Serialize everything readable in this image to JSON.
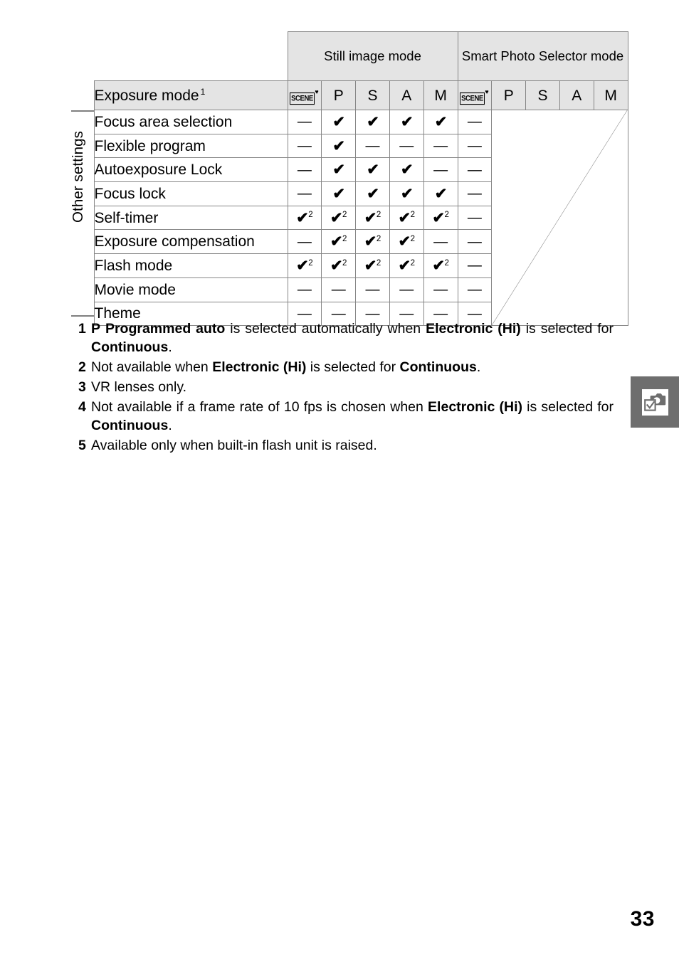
{
  "page": {
    "number": "33"
  },
  "table": {
    "side_label": "Other settings",
    "group_headers": [
      {
        "label": "Still image mode",
        "span": 5
      },
      {
        "label": "Smart Photo Selector mode",
        "span": 5
      }
    ],
    "exposure_row_label": "Exposure mode",
    "exposure_row_footnote": "1",
    "mode_columns": [
      {
        "icon": "scene-icon",
        "label": "SCENE",
        "accent": "♥"
      },
      {
        "label": "P"
      },
      {
        "label": "S"
      },
      {
        "label": "A"
      },
      {
        "label": "M"
      },
      {
        "icon": "scene-icon",
        "label": "SCENE",
        "accent": "♥"
      },
      {
        "label": "P"
      },
      {
        "label": "S"
      },
      {
        "label": "A"
      },
      {
        "label": "M"
      }
    ],
    "dash": "—",
    "check": "✔",
    "rows": [
      {
        "name": "Focus area selection",
        "cells": [
          {
            "mark": "—"
          },
          {
            "mark": "✔"
          },
          {
            "mark": "✔"
          },
          {
            "mark": "✔"
          },
          {
            "mark": "✔"
          },
          {
            "mark": "—"
          }
        ]
      },
      {
        "name": "Flexible program",
        "cells": [
          {
            "mark": "—"
          },
          {
            "mark": "✔"
          },
          {
            "mark": "—"
          },
          {
            "mark": "—"
          },
          {
            "mark": "—"
          },
          {
            "mark": "—"
          }
        ]
      },
      {
        "name": "Autoexposure Lock",
        "cells": [
          {
            "mark": "—"
          },
          {
            "mark": "✔"
          },
          {
            "mark": "✔"
          },
          {
            "mark": "✔"
          },
          {
            "mark": "—"
          },
          {
            "mark": "—"
          }
        ]
      },
      {
        "name": "Focus lock",
        "cells": [
          {
            "mark": "—"
          },
          {
            "mark": "✔"
          },
          {
            "mark": "✔"
          },
          {
            "mark": "✔"
          },
          {
            "mark": "✔"
          },
          {
            "mark": "—"
          }
        ]
      },
      {
        "name": "Self-timer",
        "cells": [
          {
            "mark": "✔",
            "note": "2"
          },
          {
            "mark": "✔",
            "note": "2"
          },
          {
            "mark": "✔",
            "note": "2"
          },
          {
            "mark": "✔",
            "note": "2"
          },
          {
            "mark": "✔",
            "note": "2"
          },
          {
            "mark": "—"
          }
        ]
      },
      {
        "name": "Exposure compensation",
        "cells": [
          {
            "mark": "—"
          },
          {
            "mark": "✔",
            "note": "2"
          },
          {
            "mark": "✔",
            "note": "2"
          },
          {
            "mark": "✔",
            "note": "2"
          },
          {
            "mark": "—"
          },
          {
            "mark": "—"
          }
        ]
      },
      {
        "name": "Flash mode",
        "cells": [
          {
            "mark": "✔",
            "note": "2"
          },
          {
            "mark": "✔",
            "note": "2"
          },
          {
            "mark": "✔",
            "note": "2"
          },
          {
            "mark": "✔",
            "note": "2"
          },
          {
            "mark": "✔",
            "note": "2"
          },
          {
            "mark": "—"
          }
        ]
      },
      {
        "name": "Movie mode",
        "cells": [
          {
            "mark": "—"
          },
          {
            "mark": "—"
          },
          {
            "mark": "—"
          },
          {
            "mark": "—"
          },
          {
            "mark": "—"
          },
          {
            "mark": "—"
          }
        ]
      },
      {
        "name": "Theme",
        "cells": [
          {
            "mark": "—"
          },
          {
            "mark": "—"
          },
          {
            "mark": "—"
          },
          {
            "mark": "—"
          },
          {
            "mark": "—"
          },
          {
            "mark": "—"
          }
        ]
      }
    ]
  },
  "footnotes": [
    {
      "num": "1",
      "html": "<span class=\"pmode\">P</span> <b>Programmed auto</b> is selected automatically when <b>Electronic (Hi)</b> is selected for <b>Continuous</b>.",
      "justify": true
    },
    {
      "num": "2",
      "html": "Not available when <b>Electronic (Hi)</b> is selected for <b>Continuous</b>.",
      "justify": false
    },
    {
      "num": "3",
      "html": "VR lenses only.",
      "justify": false
    },
    {
      "num": "4",
      "html": "Not available if a frame rate of 10 fps is chosen when <b>Electronic (Hi)</b> is selected for <b>Continuous</b>.",
      "justify": true
    },
    {
      "num": "5",
      "html": "Available only when built-in flash unit is raised.",
      "justify": false
    }
  ],
  "side_tab": {
    "icon": "camera-checkbox-icon",
    "background": "#6e6e6e"
  },
  "colors": {
    "header_shade": "#e4e4e4",
    "rule": "#7f7f7f",
    "cell_border": "#868686",
    "text": "#000000"
  }
}
